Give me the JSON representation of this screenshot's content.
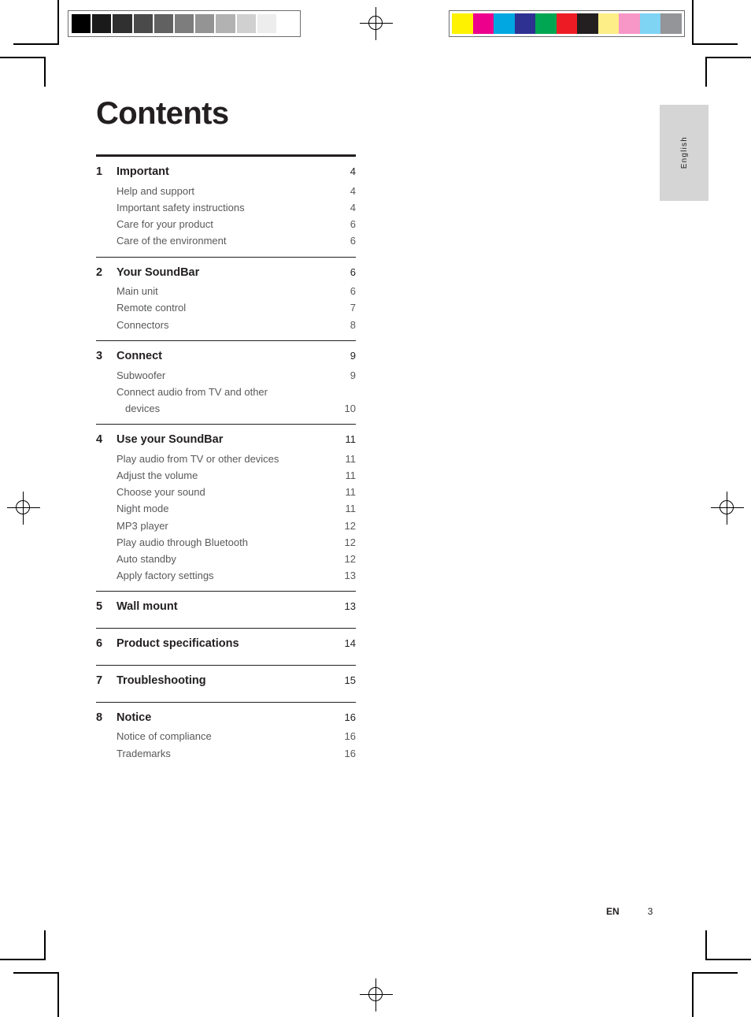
{
  "page": {
    "title": "Contents",
    "language_tab": "English",
    "footer": {
      "language_code": "EN",
      "page_number": "3"
    }
  },
  "toc": {
    "chapters": [
      {
        "number": "1",
        "title": "Important",
        "page": "4",
        "entries": [
          {
            "label": "Help and support",
            "page": "4"
          },
          {
            "label": "Important safety instructions",
            "page": "4"
          },
          {
            "label": "Care for your product",
            "page": "6"
          },
          {
            "label": "Care of the environment",
            "page": "6"
          }
        ]
      },
      {
        "number": "2",
        "title": "Your SoundBar",
        "page": "6",
        "entries": [
          {
            "label": "Main unit",
            "page": "6"
          },
          {
            "label": "Remote control",
            "page": "7"
          },
          {
            "label": "Connectors",
            "page": "8"
          }
        ]
      },
      {
        "number": "3",
        "title": "Connect",
        "page": "9",
        "entries": [
          {
            "label": "Subwoofer",
            "page": "9"
          },
          {
            "label": "Connect audio from TV and other",
            "continuation": "devices",
            "page": "10"
          }
        ]
      },
      {
        "number": "4",
        "title": "Use your SoundBar",
        "page": "11",
        "entries": [
          {
            "label": "Play audio from TV or other devices",
            "page": "11"
          },
          {
            "label": "Adjust the volume",
            "page": "11"
          },
          {
            "label": "Choose your sound",
            "page": "11"
          },
          {
            "label": "Night mode",
            "page": "11"
          },
          {
            "label": "MP3 player",
            "page": "12"
          },
          {
            "label": "Play audio through Bluetooth",
            "page": "12"
          },
          {
            "label": "Auto standby",
            "page": "12"
          },
          {
            "label": "Apply factory settings",
            "page": "13"
          }
        ]
      },
      {
        "number": "5",
        "title": "Wall mount",
        "page": "13",
        "entries": []
      },
      {
        "number": "6",
        "title": "Product specifications",
        "page": "14",
        "entries": []
      },
      {
        "number": "7",
        "title": "Troubleshooting",
        "page": "15",
        "entries": []
      },
      {
        "number": "8",
        "title": "Notice",
        "page": "16",
        "entries": [
          {
            "label": "Notice of compliance",
            "page": "16"
          },
          {
            "label": "Trademarks",
            "page": "16"
          }
        ]
      }
    ]
  },
  "calibration": {
    "grayscale_patches": [
      "#000000",
      "#1a1a1a",
      "#303030",
      "#4a4a4a",
      "#616161",
      "#7d7d7d",
      "#949494",
      "#b2b2b2",
      "#d0d0d0",
      "#ededed",
      "#ffffff"
    ],
    "color_patches": [
      "#fff200",
      "#ec008c",
      "#00a7e1",
      "#2e3192",
      "#00a651",
      "#ed1c24",
      "#231f20",
      "#fdee87",
      "#f797c8",
      "#7fd4f4",
      "#939598"
    ]
  }
}
